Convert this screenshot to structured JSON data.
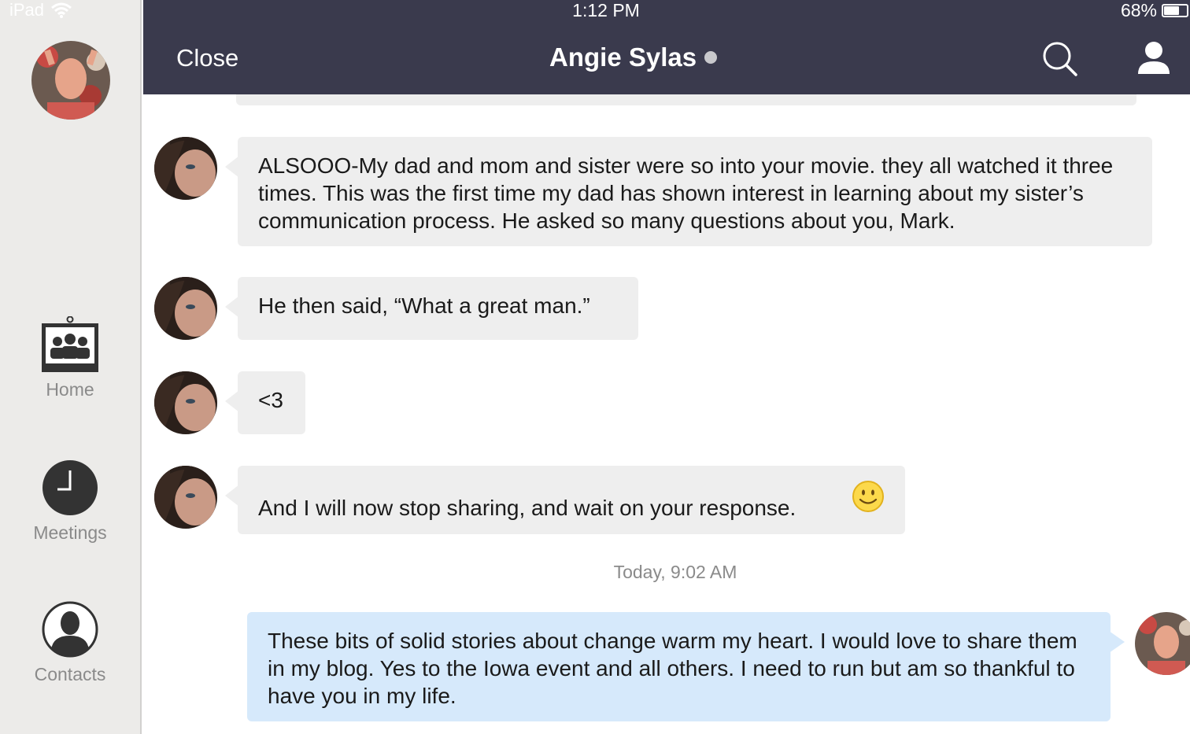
{
  "status_bar": {
    "device": "iPad",
    "time": "1:12 PM",
    "battery": "68%",
    "battery_level": 0.68
  },
  "sidebar": {
    "items": [
      {
        "label": "Home",
        "icon": "group-icon"
      },
      {
        "label": "Meetings",
        "icon": "clock-icon"
      },
      {
        "label": "Contacts",
        "icon": "person-icon"
      }
    ]
  },
  "header": {
    "close_label": "Close",
    "contact_name": "Angie Sylas"
  },
  "messages": [
    {
      "from": "contact",
      "text": "ALSOOO-My dad and mom and sister were so into your movie. they all watched it three times. This was the first time my dad has shown interest in learning about my sister’s communication process. He asked so many questions about you, Mark."
    },
    {
      "from": "contact",
      "text": "He then said, “What a great man.”"
    },
    {
      "from": "contact",
      "text": "<3"
    },
    {
      "from": "contact",
      "text": "And I will now stop sharing, and wait on your response."
    },
    {
      "from": "me",
      "text": "These bits of solid stories about change warm my heart. I would love to share them in my blog. Yes to the Iowa event and all others. I need to run but am so thankful to have you in my life."
    }
  ],
  "timestamp": "Today, 9:02 AM",
  "colors": {
    "header_bg": "#3a3a4d",
    "incoming_bubble": "#eeeeee",
    "outgoing_bubble": "#d6e9fb",
    "sidebar_bg": "#ecebe9"
  }
}
